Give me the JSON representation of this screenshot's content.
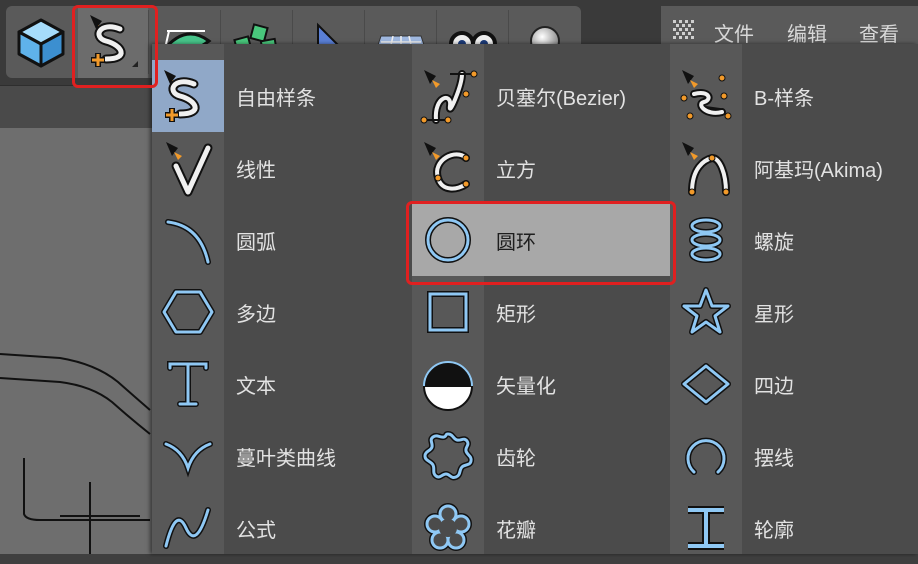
{
  "menubar": {
    "items": [
      "文件",
      "编辑",
      "查看"
    ]
  },
  "toolbar": {
    "tools": [
      "cube-object",
      "spline-pen",
      "deformer",
      "generator",
      "environment",
      "floor",
      "camera",
      "light"
    ]
  },
  "spline_menu": {
    "col1": [
      "自由样条",
      "线性",
      "圆弧",
      "多边",
      "文本",
      "蔓叶类曲线",
      "公式"
    ],
    "col2": [
      "贝塞尔(Bezier)",
      "立方",
      "圆环",
      "矩形",
      "矢量化",
      "齿轮",
      "花瓣"
    ],
    "col3": [
      "B-样条",
      "阿基玛(Akima)",
      "螺旋",
      "星形",
      "四边",
      "摆线",
      "轮廓"
    ],
    "active_item": "圆环"
  },
  "colors": {
    "highlight": "#e02020",
    "icon_blue": "#8fc8f4",
    "accent_orange": "#f29a2a"
  }
}
